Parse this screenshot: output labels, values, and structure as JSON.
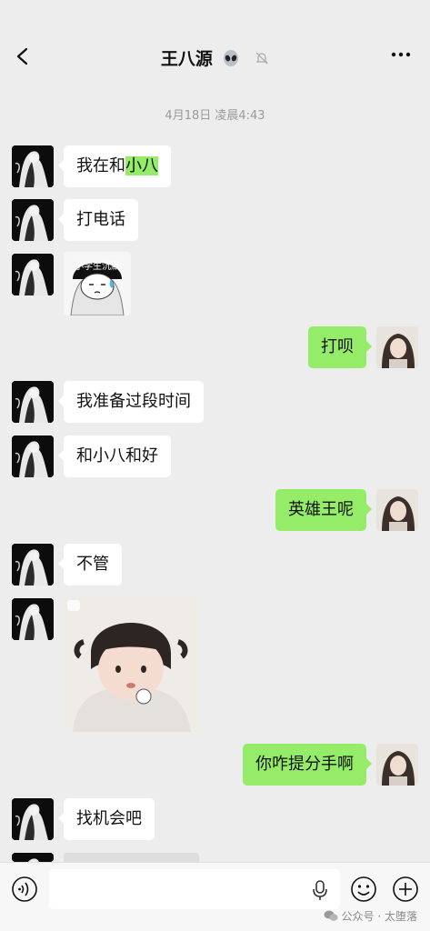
{
  "header": {
    "title": "王八源",
    "title_emoji": "alien-icon",
    "mute_icon": "bell-slash-icon",
    "more_icon": "more-dots-icon",
    "back_icon": "chevron-left-icon"
  },
  "timestamp": "4月18日 凌晨4:43",
  "messages": [
    {
      "side": "left",
      "type": "text",
      "text_pre": "我在和",
      "text_hl": "小八"
    },
    {
      "side": "left",
      "type": "text",
      "text": "打电话"
    },
    {
      "side": "left",
      "type": "sticker",
      "caption": "小学生沉默"
    },
    {
      "side": "right",
      "type": "text",
      "text": "打呗"
    },
    {
      "side": "left",
      "type": "text",
      "text": "我准备过段时间"
    },
    {
      "side": "left",
      "type": "text",
      "text": "和小八和好"
    },
    {
      "side": "right",
      "type": "text",
      "text": "英雄王呢"
    },
    {
      "side": "left",
      "type": "text",
      "text": "不管"
    },
    {
      "side": "left",
      "type": "sticker",
      "caption": ""
    },
    {
      "side": "right",
      "type": "text",
      "text": "你咋提分手啊"
    },
    {
      "side": "left",
      "type": "text",
      "text": "找机会吧"
    }
  ],
  "input_bar": {
    "voice_icon": "voice-icon",
    "mic_icon": "mic-icon",
    "emoji_icon": "emoji-icon",
    "plus_icon": "plus-icon",
    "watermark": "公众号 · 太堕落"
  },
  "colors": {
    "background": "#ededed",
    "sent_bubble": "#95ec69",
    "received_bubble": "#ffffff"
  }
}
